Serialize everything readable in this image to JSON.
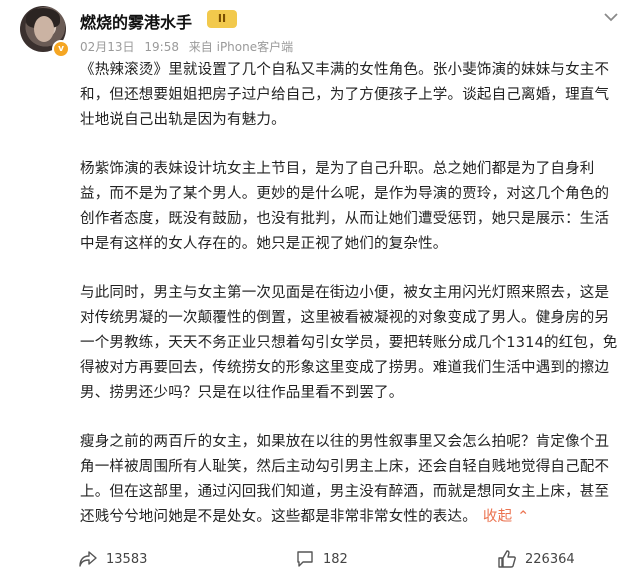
{
  "post": {
    "username": "燃烧的雾港水手",
    "level_badge": "II",
    "verified_badge": "v",
    "date": "02月13日",
    "time": "19:58",
    "source": "来自 iPhone客户端"
  },
  "paragraphs": [
    "《热辣滚烫》里就设置了几个自私又丰满的女性角色。张小斐饰演的妹妹与女主不和，但还想要姐姐把房子过户给自己，为了方便孩子上学。谈起自己离婚，理直气壮地说自己出轨是因为有魅力。",
    "杨紫饰演的表妹设计坑女主上节目，是为了自己升职。总之她们都是为了自身利益，而不是为了某个男人。更妙的是什么呢，是作为导演的贾玲，对这几个角色的创作者态度，既没有鼓励，也没有批判，从而让她们遭受惩罚，她只是展示：生活中是有这样的女人存在的。她只是正视了她们的复杂性。",
    "与此同时，男主与女主第一次见面是在街边小便，被女主用闪光灯照来照去，这是对传统男凝的一次颠覆性的倒置，这里被看被凝视的对象变成了男人。健身房的另一个男教练，天天不务正业只想着勾引女学员，要把转账分成几个1314的红包，免得被对方再要回去，传统捞女的形象这里变成了捞男。难道我们生活中遇到的擦边男、捞男还少吗？只是在以往作品里看不到罢了。",
    "瘦身之前的两百斤的女主，如果放在以往的男性叙事里又会怎么拍呢？肯定像个丑角一样被周围所有人耻笑，然后主动勾引男主上床，还会自轻自贱地觉得自己配不上。但在这部里，通过闪回我们知道，男主没有醉酒，而就是想同女主上床，甚至还贱兮兮地问她是不是处女。这些都是非常非常女性的表达。"
  ],
  "collapse_label": "收起",
  "collapse_arrow": "⌃",
  "actions": {
    "share_count": "13583",
    "comment_count": "182",
    "like_count": "226364"
  },
  "icons": {
    "more": "chevron-down-icon",
    "share": "share-icon",
    "comment": "comment-icon",
    "like": "thumbs-up-icon"
  },
  "colors": {
    "accent": "#eb7350",
    "meta": "#9a9a9a",
    "badge": "#f2c94c"
  }
}
